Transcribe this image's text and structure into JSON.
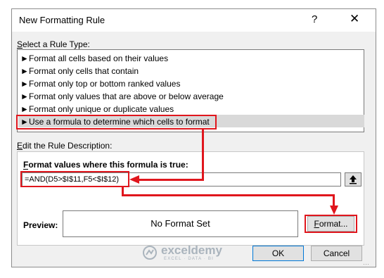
{
  "dialog": {
    "title": "New Formatting Rule",
    "help_glyph": "?",
    "close_glyph": "✕"
  },
  "rule_type": {
    "label_first": "S",
    "label_rest": "elect a Rule Type:",
    "items": [
      {
        "label": "Format all cells based on their values"
      },
      {
        "label": "Format only cells that contain"
      },
      {
        "label": "Format only top or bottom ranked values"
      },
      {
        "label": "Format only values that are above or below average"
      },
      {
        "label": "Format only unique or duplicate values"
      },
      {
        "label": "Use a formula to determine which cells to format"
      }
    ],
    "selected_index": 5,
    "arrow_glyph": "►"
  },
  "description": {
    "label_first": "E",
    "label_rest": "dit the Rule Description:",
    "formula_label_first": "O",
    "formula_label_rest": "Format values where this formula is true:",
    "formula_value": "=AND(D5>$I$11,F5<$I$12)",
    "preview_label": "Preview:",
    "preview_text": "No Format Set",
    "format_button_first": "F",
    "format_button_rest": "ormat..."
  },
  "buttons": {
    "ok": "OK",
    "cancel": "Cancel"
  },
  "watermark": {
    "name": "exceldemy",
    "tagline": "EXCEL · DATA · BI"
  },
  "colors": {
    "highlight": "#e0161d",
    "selection": "#d9d9d9",
    "dialog_bg": "#f0f0f0"
  }
}
